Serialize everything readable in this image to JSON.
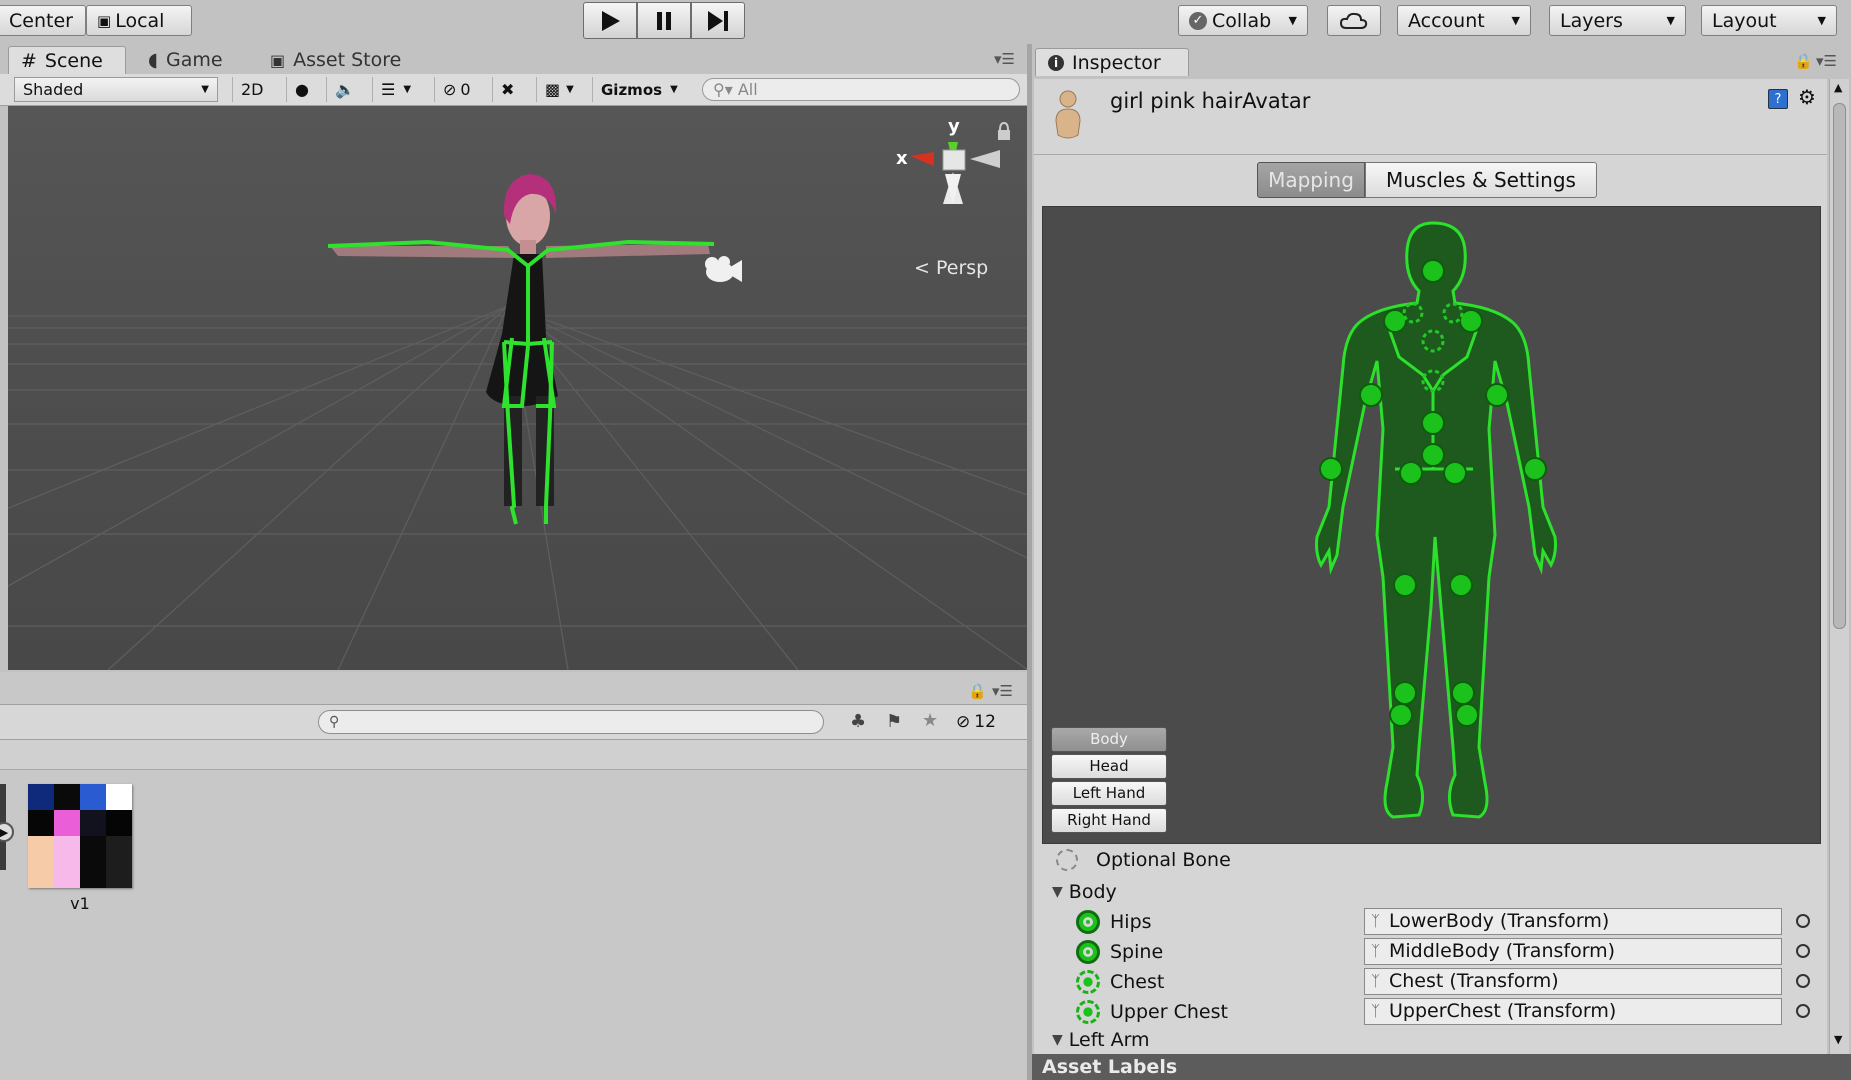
{
  "toolbar": {
    "pivot_label": "Center",
    "space_label": "Local",
    "collab_label": "Collab",
    "account_label": "Account",
    "layers_label": "Layers",
    "layout_label": "Layout"
  },
  "scene_panel": {
    "tabs": [
      {
        "label": "Scene",
        "icon": "hash-icon",
        "active": true
      },
      {
        "label": "Game",
        "icon": "pacman-icon",
        "active": false
      },
      {
        "label": "Asset Store",
        "icon": "shop-icon",
        "active": false
      }
    ],
    "shading_mode": "Shaded",
    "mode_2d": "2D",
    "hidden_count": "0",
    "gizmos_label": "Gizmos",
    "search_placeholder": "All",
    "gizmo": {
      "y_label": "y",
      "x_label": "x",
      "projection": "Persp"
    }
  },
  "project_panel": {
    "visible_count": "12",
    "asset": {
      "label": "v1"
    }
  },
  "inspector": {
    "tab_label": "Inspector",
    "object_name": "girl pink hairAvatar",
    "tabs": [
      {
        "label": "Mapping",
        "active": true
      },
      {
        "label": "Muscles & Settings",
        "active": false
      }
    ],
    "body_parts": [
      "Body",
      "Head",
      "Left Hand",
      "Right Hand"
    ],
    "optional_bone_label": "Optional Bone",
    "body_group": "Body",
    "bones": [
      {
        "name": "Hips",
        "value": "LowerBody (Transform)",
        "required": true
      },
      {
        "name": "Spine",
        "value": "MiddleBody (Transform)",
        "required": true
      },
      {
        "name": "Chest",
        "value": "Chest (Transform)",
        "required": false
      },
      {
        "name": "Upper Chest",
        "value": "UpperChest (Transform)",
        "required": false
      }
    ],
    "next_group": "Left Arm",
    "asset_labels": "Asset Labels"
  },
  "colors": {
    "bone_green": "#1cc21c",
    "scene_bg": "#4f4f4f"
  }
}
